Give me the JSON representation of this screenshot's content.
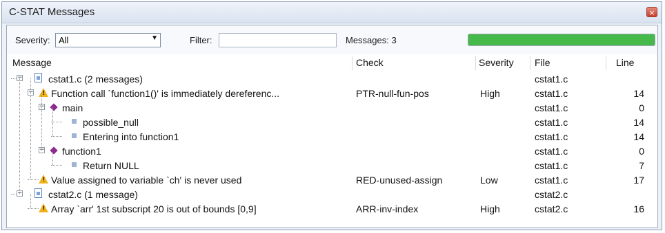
{
  "window": {
    "title": "C-STAT Messages",
    "close_symbol": "×"
  },
  "toolbar": {
    "severity_label": "Severity:",
    "severity_value": "All",
    "filter_label": "Filter:",
    "filter_value": "",
    "messages_count": "Messages: 3",
    "progress_fraction": 1.0
  },
  "columns": {
    "message": "Message",
    "check": "Check",
    "severity": "Severity",
    "file": "File",
    "line": "Line"
  },
  "rows": [
    {
      "message": "cstat1.c  (2 messages)",
      "check": "",
      "severity": "",
      "file": "cstat1.c",
      "line": ""
    },
    {
      "message": "Function call `function1()' is immediately dereferenc...",
      "check": "PTR-null-fun-pos",
      "severity": "High",
      "file": "cstat1.c",
      "line": "14"
    },
    {
      "message": "main",
      "check": "",
      "severity": "",
      "file": "cstat1.c",
      "line": "0"
    },
    {
      "message": "possible_null",
      "check": "",
      "severity": "",
      "file": "cstat1.c",
      "line": "14"
    },
    {
      "message": "Entering into function1",
      "check": "",
      "severity": "",
      "file": "cstat1.c",
      "line": "14"
    },
    {
      "message": "function1",
      "check": "",
      "severity": "",
      "file": "cstat1.c",
      "line": "0"
    },
    {
      "message": "Return NULL",
      "check": "",
      "severity": "",
      "file": "cstat1.c",
      "line": "7"
    },
    {
      "message": "Value assigned to variable `ch' is never used",
      "check": "RED-unused-assign",
      "severity": "Low",
      "file": "cstat1.c",
      "line": "17"
    },
    {
      "message": "cstat2.c  (1 message)",
      "check": "",
      "severity": "",
      "file": "cstat2.c",
      "line": ""
    },
    {
      "message": "Array `arr' 1st subscript 20 is out of bounds [0,9]",
      "check": "ARR-inv-index",
      "severity": "High",
      "file": "cstat2.c",
      "line": "16"
    }
  ],
  "icons": {
    "file": "file-icon",
    "warning": "warning-icon",
    "function": "diamond-icon",
    "step": "square-icon",
    "collapse": "collapse-icon",
    "dropdown": "chevron-down-icon"
  },
  "colors": {
    "progress": "#46b94b",
    "warning": "#f1b31c",
    "function": "#8d2a8f"
  }
}
